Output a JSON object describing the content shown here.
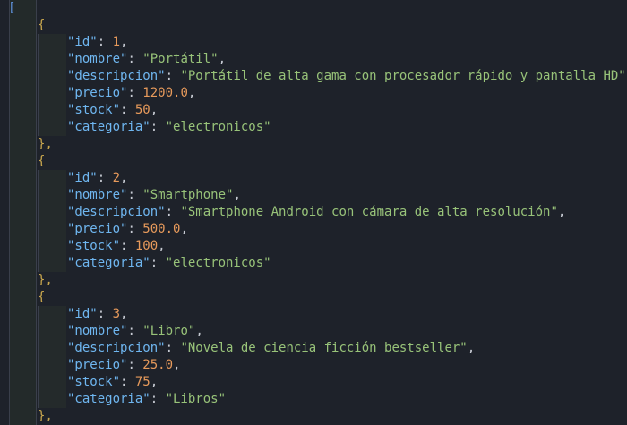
{
  "editor": {
    "open_bracket": "[",
    "open_brace": "{",
    "close_brace_comma": "},",
    "colors": {
      "background": "#1e222a",
      "key": "#6fb6f0",
      "string": "#98c379",
      "number": "#e79a5b",
      "brace": "#c9a74e",
      "bracket": "#5d8fd6"
    }
  },
  "objects": [
    {
      "id": "1",
      "nombre": "\"Portátil\"",
      "descripcion": "\"Portátil de alta gama con procesador rápido y pantalla HD\"",
      "precio": "1200.0",
      "stock": "50",
      "categoria": "\"electronicos\""
    },
    {
      "id": "2",
      "nombre": "\"Smartphone\"",
      "descripcion": "\"Smartphone Android con cámara de alta resolución\"",
      "precio": "500.0",
      "stock": "100",
      "categoria": "\"electronicos\""
    },
    {
      "id": "3",
      "nombre": "\"Libro\"",
      "descripcion": "\"Novela de ciencia ficción bestseller\"",
      "precio": "25.0",
      "stock": "75",
      "categoria": "\"Libros\""
    }
  ],
  "keys": {
    "id": "\"id\"",
    "nombre": "\"nombre\"",
    "descripcion": "\"descripcion\"",
    "precio": "\"precio\"",
    "stock": "\"stock\"",
    "categoria": "\"categoria\""
  }
}
